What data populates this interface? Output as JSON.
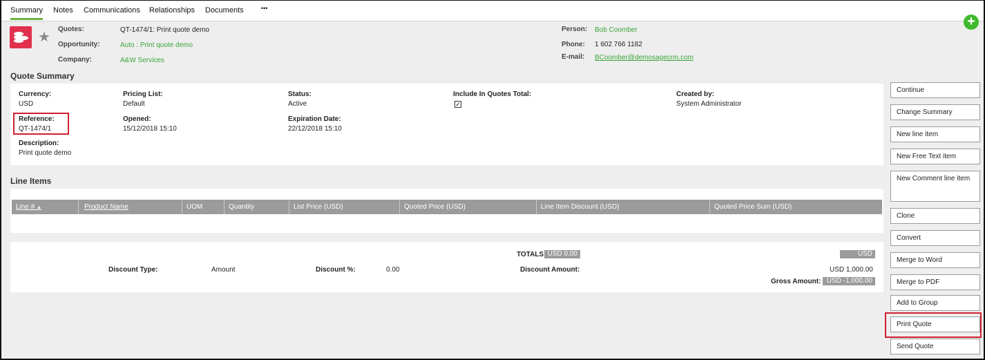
{
  "tabs": [
    "Summary",
    "Notes",
    "Communications",
    "Relationships",
    "Documents",
    "•••"
  ],
  "header": {
    "quotes_label": "Quotes:",
    "quotes_value": "QT-1474/1: Print quote demo",
    "opportunity_label": "Opportunity:",
    "opportunity_value": "Auto : Print quote demo",
    "company_label": "Company:",
    "company_value": "A&W Services",
    "person_label": "Person:",
    "person_value": "Bob Coomber",
    "phone_label": "Phone:",
    "phone_value": "1 602 766 1182",
    "email_label": "E-mail:",
    "email_value": "BCoomber@demosagecrm.com"
  },
  "summary": {
    "title": "Quote Summary",
    "currency_label": "Currency:",
    "currency_value": "USD",
    "pricing_label": "Pricing List:",
    "pricing_value": "Default",
    "status_label": "Status:",
    "status_value": "Active",
    "include_label": "Include In Quotes Total:",
    "include_checked": "✓",
    "created_label": "Created by:",
    "created_value": "System Administrator",
    "reference_label": "Reference:",
    "reference_value": "QT-1474/1",
    "opened_label": "Opened:",
    "opened_value": "15/12/2018 15:10",
    "expiration_label": "Expiration Date:",
    "expiration_value": "22/12/2018 15:10",
    "description_label": "Description:",
    "description_value": "Print quote demo"
  },
  "line_items": {
    "title": "Line Items",
    "columns": [
      "Line #",
      "Product Name",
      "UOM",
      "Quantity",
      "List Price (USD)",
      "Quoted Price (USD)",
      "Line Item Discount (USD)",
      "Quoted Price Sum (USD)"
    ],
    "sort_indicator": "▲",
    "totals_label": "TOTALS",
    "totals_value": "USD 0.00",
    "totals_sum": "USD 0.00",
    "discount_type_label": "Discount Type:",
    "discount_type_value": "Amount",
    "discount_pct_label": "Discount %:",
    "discount_pct_value": "0.00",
    "discount_amount_label": "Discount Amount:",
    "discount_amount_value": "USD 1,000.00",
    "gross_label": "Gross Amount:",
    "gross_value": "USD -1,000.00"
  },
  "actions": [
    "Continue",
    "Change Summary",
    "New line item",
    "New Free Text item",
    "New Comment line item",
    "Clone",
    "Convert",
    "Merge to Word",
    "Merge to PDF",
    "Add to Group",
    "Print Quote",
    "Send Quote"
  ],
  "colors": {
    "accent_green": "#6db33f",
    "link_green": "#3aa53a",
    "highlight_red": "#d01f2f",
    "entity_icon": "#e0304e"
  }
}
